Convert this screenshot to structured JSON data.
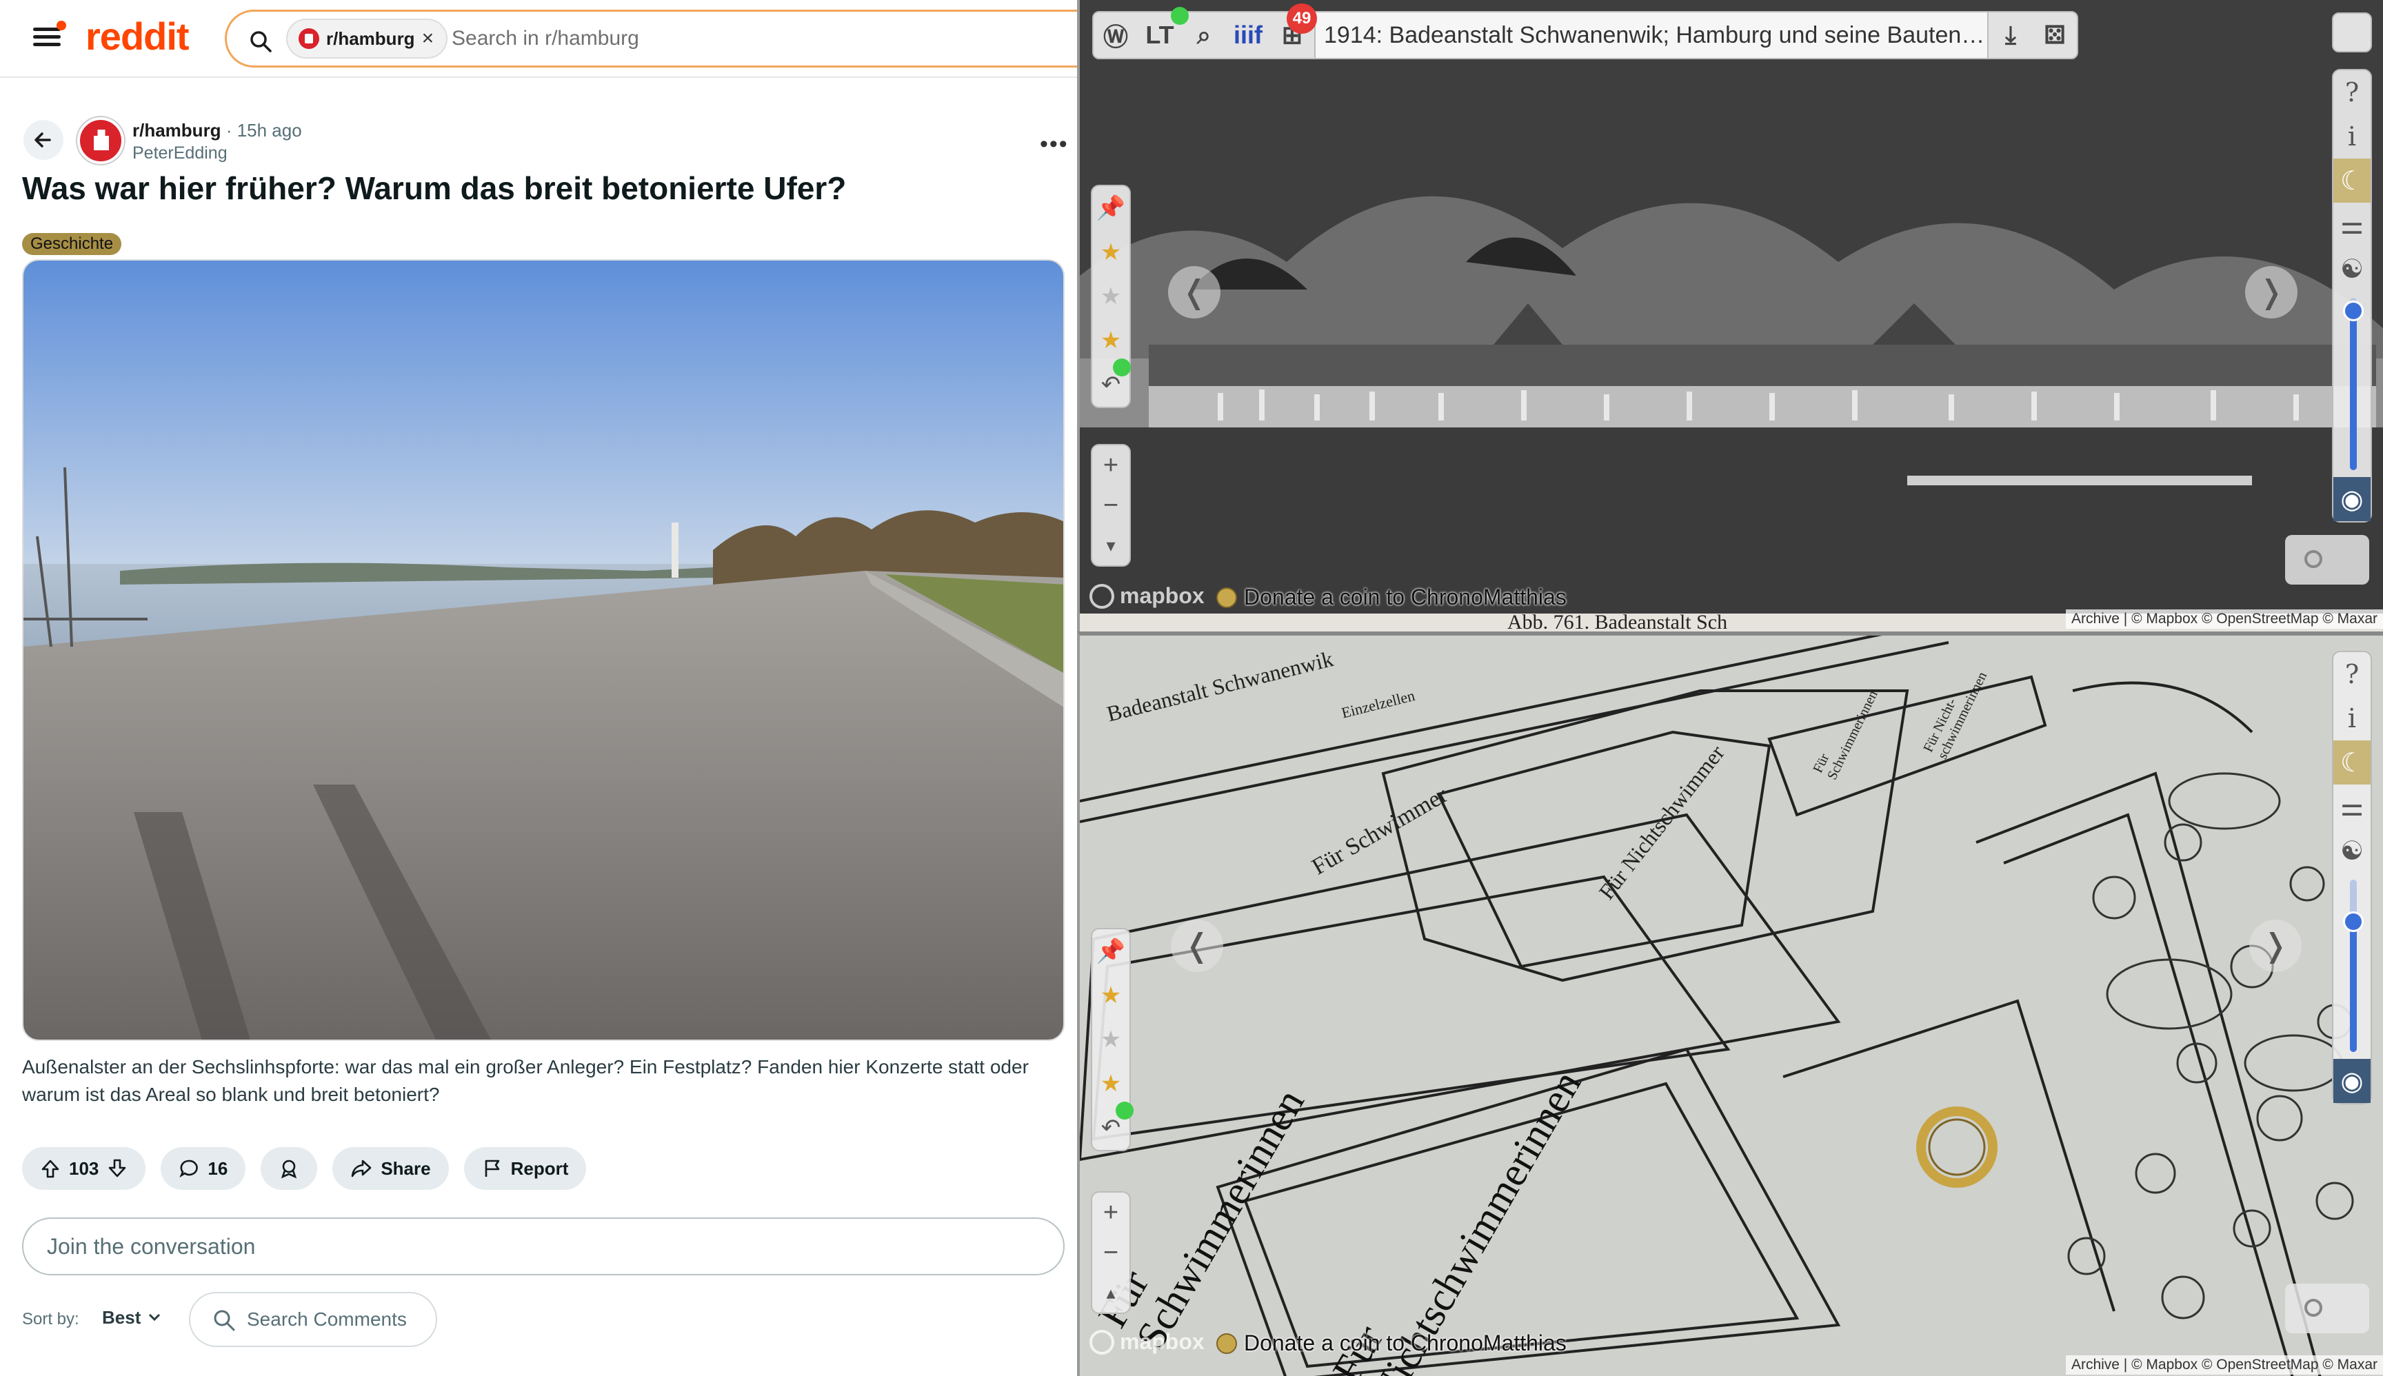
{
  "reddit": {
    "logo": "reddit",
    "search": {
      "chip_label": "r/hamburg",
      "chip_close": "×",
      "placeholder": "Search in r/hamburg"
    },
    "post": {
      "subreddit": "r/hamburg",
      "time": "· 15h ago",
      "author": "PeterEdding",
      "more": "•••",
      "title": "Was war hier früher? Warum das breit betonierte Ufer?",
      "flair": "Geschichte",
      "body": "Außenalster an der Sechslinhspforte: war das mal ein großer Anleger? Ein Festplatz? Fanden hier Konzerte statt oder warum ist das Areal so blank und breit betoniert?",
      "votes": "103",
      "comments": "16",
      "share": "Share",
      "report": "Report"
    },
    "join_placeholder": "Join the conversation",
    "sort_label": "Sort by:",
    "sort_value": "Best",
    "search_comments": "Search Comments"
  },
  "viewer": {
    "badge_count": "49",
    "iiif_label": "iiif",
    "title": "1914: Badeanstalt Schwanenwik; Hamburg und seine Bauten 1914,...",
    "prev": "❬",
    "next": "❭",
    "mapbox_logo": "mapbox",
    "donate": "Donate a coin to ChronoMatthias",
    "attribution": "Archive | © Mapbox © OpenStreetMap © Maxar",
    "photo_caption": "Abb. 761. Badeanstalt Sch",
    "map_labels": {
      "title": "Badeanstalt Schwanenwik",
      "einzelzellen": "Einzelzellen",
      "schwimmer": "Für Schwimmer",
      "nichtschwimmer": "Für Nichtschwimmer",
      "schwimmerinnen": "Für Schwimmerinnen",
      "nichtschwimmerinnen": "Für Nichtschwimmerinnen",
      "top_schwimmerinnen": "Für Schwimmerinnen",
      "top_nicht": "Für Nicht-schwimmerinnen"
    }
  },
  "colors": {
    "reddit_orange": "#ff4500",
    "flair": "#a68e45",
    "slider_blue": "#3b6fd8"
  }
}
